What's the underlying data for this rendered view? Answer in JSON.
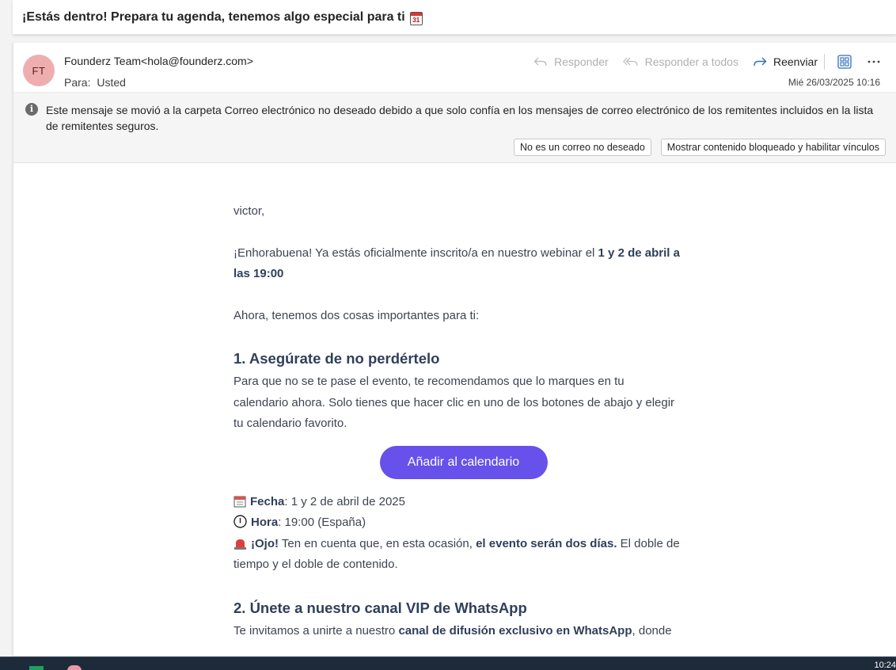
{
  "subject": "¡Estás dentro! Prepara tu agenda, tenemos algo especial para ti",
  "subject_emoji_day": "31",
  "sender": {
    "initials": "FT",
    "display": "Founderz Team<hola@founderz.com>",
    "to_label": "Para:",
    "to_value": "Usted",
    "date": "Mié 26/03/2025 10:16"
  },
  "actions": {
    "reply": "Responder",
    "reply_all": "Responder a todos",
    "forward": "Reenviar"
  },
  "junk_banner": {
    "text": "Este mensaje se movió a la carpeta Correo electrónico no deseado debido a que solo confía en los mensajes de correo electrónico de los remitentes incluidos en la lista de remitentes seguros.",
    "not_junk_button": "No es un correo no deseado",
    "show_blocked_button": "Mostrar contenido bloqueado y habilitar vínculos"
  },
  "body": {
    "greeting": "victor,",
    "p1_a": "¡Enhorabuena! Ya estás oficialmente inscrito/a en nuestro webinar el ",
    "p1_b": "1 y 2 de abril a las 19:00",
    "p2": "Ahora, tenemos dos cosas importantes para ti:",
    "h1": "1. Asegúrate de no perdértelo",
    "p3": "Para que no se te pase el evento, te recomendamos que lo marques en tu calendario ahora. Solo tienes que hacer clic en uno de los botones de abajo y elegir tu calendario favorito.",
    "cta": "Añadir al calendario",
    "fecha_label": "Fecha",
    "fecha_value": ": 1 y 2 de abril de 2025",
    "hora_label": "Hora",
    "hora_value": ": 19:00 (España)",
    "ojo_a": "¡Ojo!",
    "ojo_b": " Ten en cuenta que, en esta ocasión, ",
    "ojo_c": "el evento serán dos días.",
    "ojo_d": " El doble de tiempo y el doble de contenido.",
    "h2": "2. Únete a nuestro canal VIP de WhatsApp",
    "p4_a": "Te invitamos a unirte a nuestro ",
    "p4_b": "canal de difusión exclusivo en WhatsApp",
    "p4_c": ", donde"
  },
  "taskbar": {
    "time": "10:24"
  },
  "colors": {
    "cta": "#6651ea",
    "avatar": "#eeaeb0",
    "heading": "#2f3f5a",
    "taskbar": "#1c2a3a"
  }
}
